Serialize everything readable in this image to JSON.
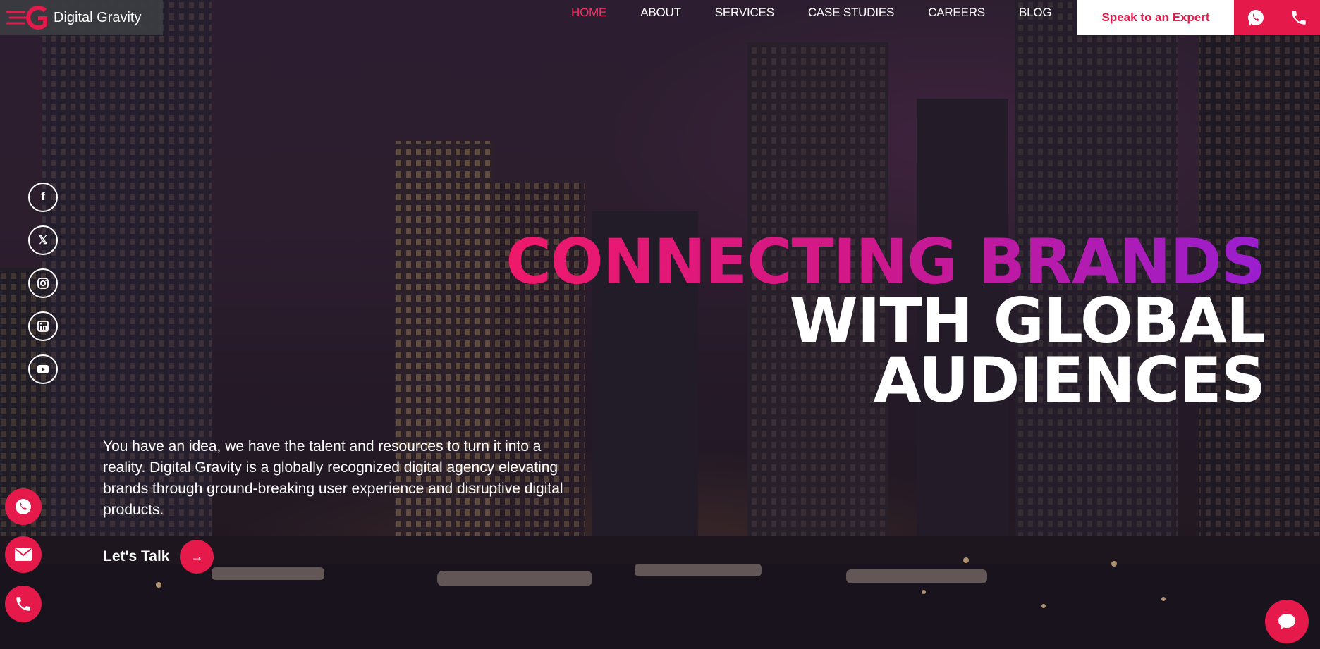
{
  "brand": {
    "name": "Digital Gravity",
    "accent": "#e6194b"
  },
  "nav": {
    "items": [
      {
        "label": "HOME",
        "active": true
      },
      {
        "label": "ABOUT",
        "active": false
      },
      {
        "label": "SERVICES",
        "active": false
      },
      {
        "label": "CASE STUDIES",
        "active": false
      },
      {
        "label": "CAREERS",
        "active": false
      },
      {
        "label": "BLOG",
        "active": false
      }
    ]
  },
  "header": {
    "cta_label": "Speak to an Expert",
    "whatsapp_icon": "whatsapp-icon",
    "phone_icon": "phone-icon"
  },
  "social": [
    "facebook-icon",
    "x-icon",
    "instagram-icon",
    "linkedin-icon",
    "youtube-icon"
  ],
  "hero": {
    "line1": "CONNECTING BRANDS",
    "line2": "WITH GLOBAL",
    "line3": "AUDIENCES",
    "description": "You have an idea, we have the talent and resources to turn it into a reality. Digital Gravity is a globally recognized digital agency elevating brands through ground-breaking user experience and disruptive digital products.",
    "cta_label": "Let's Talk",
    "cta_arrow": "→"
  },
  "floating": [
    "whatsapp-icon",
    "mail-icon",
    "phone-icon"
  ],
  "chat": {
    "icon": "chat-bubble-icon"
  }
}
